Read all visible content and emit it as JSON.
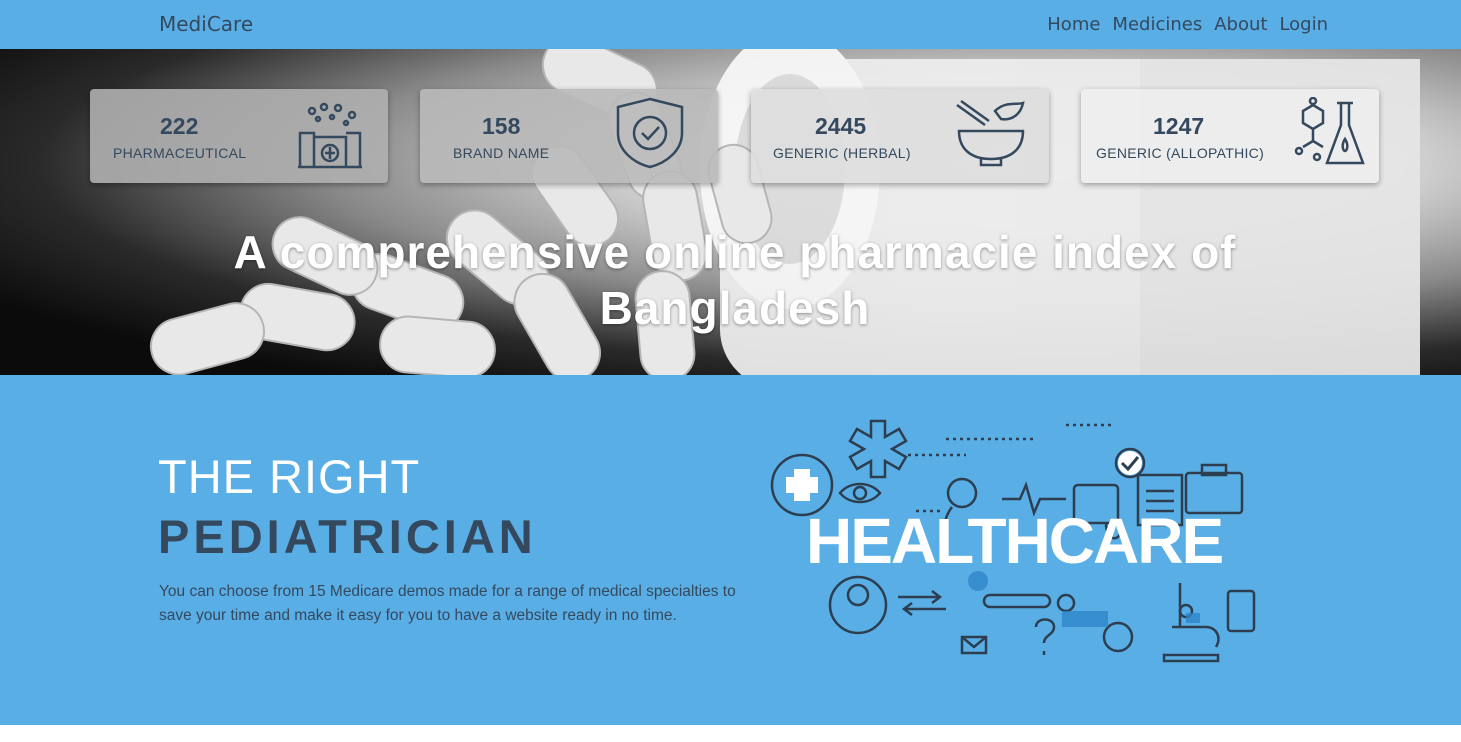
{
  "navbar": {
    "brand": "MediCare",
    "links": [
      "Home",
      "Medicines",
      "About",
      "Login"
    ]
  },
  "hero": {
    "stats": [
      {
        "value": "222",
        "label": "PHARMACEUTICAL",
        "icon": "factory-icon"
      },
      {
        "value": "158",
        "label": "BRAND NAME",
        "icon": "shield-check-icon"
      },
      {
        "value": "2445",
        "label": "GENERIC (HERBAL)",
        "icon": "mortar-pestle-icon"
      },
      {
        "value": "1247",
        "label": "GENERIC (ALLOPATHIC)",
        "icon": "molecule-flask-icon"
      }
    ],
    "title": "A comprehensive online pharmacie index of Bangladesh"
  },
  "feature": {
    "line1": "THE RIGHT",
    "line2": "PEDIATRICIAN",
    "text": "You can choose from 15 Medicare demos made for a range of medical specialties to save your time and make it easy for you to have a website ready in no time.",
    "image_text": "HEALTHCARE"
  },
  "colors": {
    "accent": "#5aaee6",
    "dark": "#34495e"
  }
}
